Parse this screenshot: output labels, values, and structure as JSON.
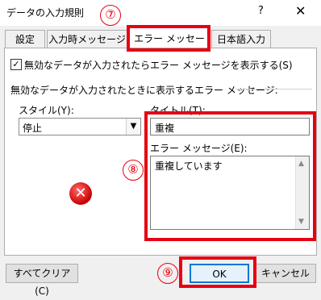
{
  "window": {
    "title": "データの入力規則",
    "help": "?",
    "close": "✕"
  },
  "tabs": [
    {
      "label": "設定"
    },
    {
      "label": "入力時メッセージ"
    },
    {
      "label": "エラー メッセージ"
    },
    {
      "label": "日本語入力"
    }
  ],
  "content": {
    "show_error_checkbox_label": "無効なデータが入力されたらエラー メッセージを表示する(S)",
    "section_label": "無効なデータが入力されたときに表示するエラー メッセージ:",
    "style_label": "スタイル(Y):",
    "style_value": "停止",
    "title_label": "タイトル(T):",
    "title_value": "重複",
    "error_message_label": "エラー メッセージ(E):",
    "error_message_value": "重複しています"
  },
  "buttons": {
    "clear_all": "すべてクリア(C)",
    "ok": "OK",
    "cancel": "キャンセル"
  },
  "annotations": {
    "step7": "⑦",
    "step8": "⑧",
    "step9": "⑨"
  },
  "colors": {
    "annotation_red": "#e60012",
    "ok_blue": "#0078d7"
  }
}
